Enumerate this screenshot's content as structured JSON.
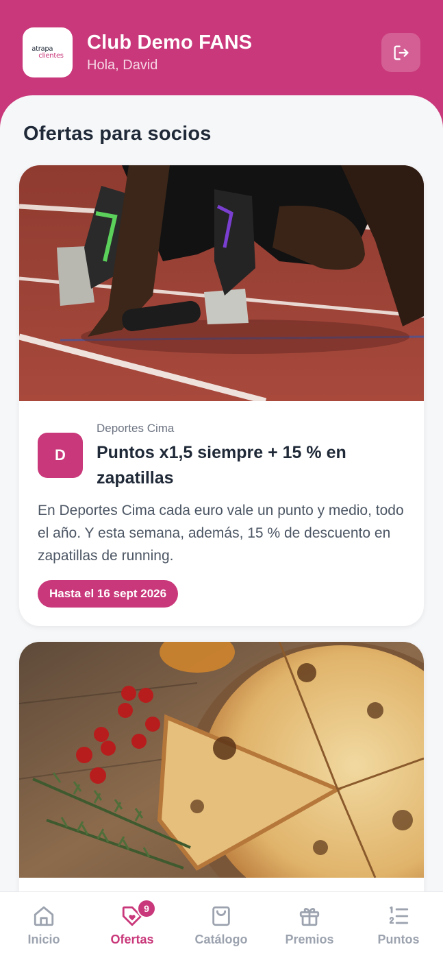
{
  "header": {
    "logo_line1": "atrapa",
    "logo_line2": "clientes",
    "title": "Club Demo FANS",
    "greeting": "Hola, David",
    "logout_icon": "logout-icon"
  },
  "main": {
    "section_title": "Ofertas para socios",
    "offers": [
      {
        "image": "running-track-sprinter-photo",
        "merchant_initial": "D",
        "merchant": "Deportes Cima",
        "title": "Puntos x1,5 siempre + 15 % en zapatillas",
        "description": "En Deportes Cima cada euro vale un punto y medio, todo el año. Y esta semana, además, 15 % de descuento en zapatillas de running.",
        "valid_until": "Hasta el 16 sept 2026"
      },
      {
        "image": "pizza-on-wooden-board-photo"
      }
    ]
  },
  "bottom_nav": {
    "items": [
      {
        "label": "Inicio",
        "icon": "home-icon",
        "active": false
      },
      {
        "label": "Ofertas",
        "icon": "tag-heart-icon",
        "active": true,
        "badge": "9"
      },
      {
        "label": "Catálogo",
        "icon": "shopping-bag-icon",
        "active": false
      },
      {
        "label": "Premios",
        "icon": "gift-icon",
        "active": false
      },
      {
        "label": "Puntos",
        "icon": "numbered-list-icon",
        "active": false
      }
    ]
  },
  "colors": {
    "brand": "#c9387a",
    "background": "#f6f7f9",
    "inactive_nav": "#9ca3af"
  }
}
